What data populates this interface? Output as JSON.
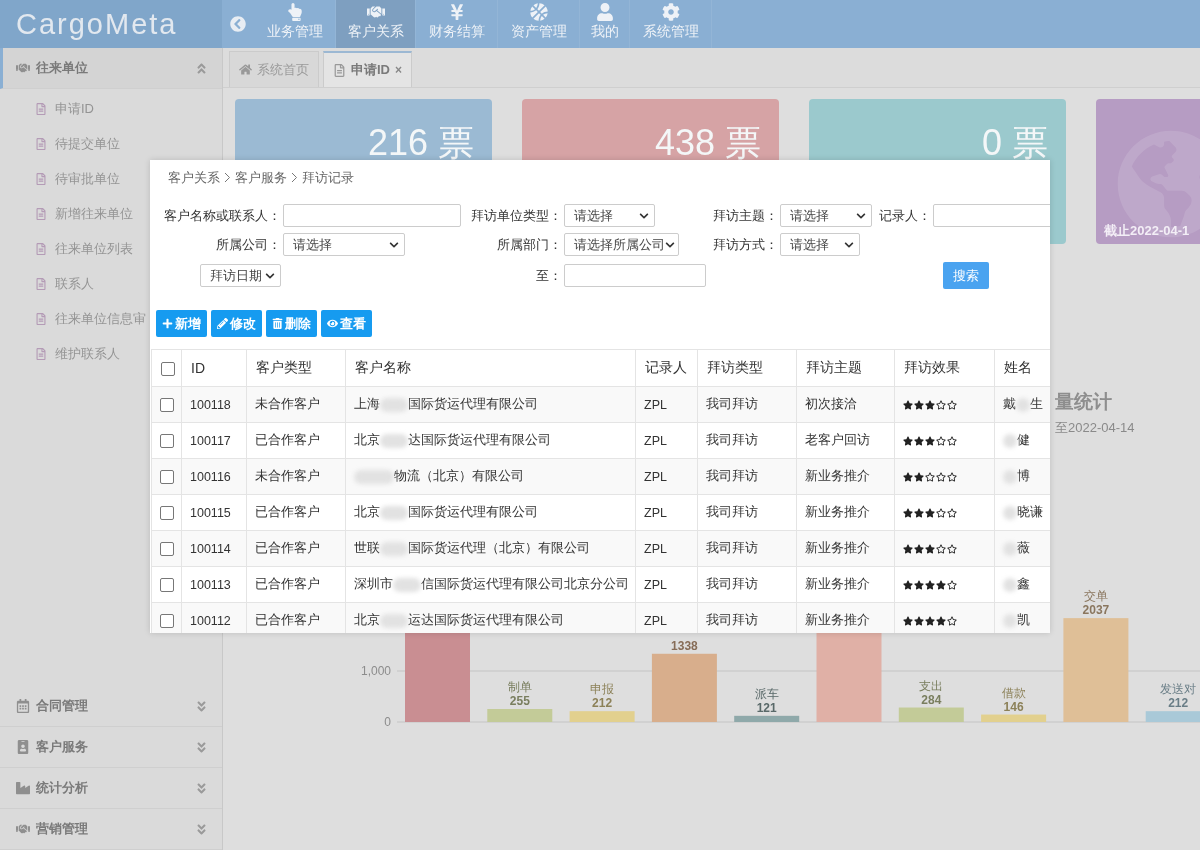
{
  "header": {
    "logo": "CargoMeta",
    "nav": [
      {
        "label": "业务管理",
        "selected": false
      },
      {
        "label": "客户关系",
        "selected": true
      },
      {
        "label": "财务结算",
        "selected": false
      },
      {
        "label": "资产管理",
        "selected": false
      },
      {
        "label": "我的",
        "selected": false
      },
      {
        "label": "系统管理",
        "selected": false
      }
    ]
  },
  "sidebar": {
    "sections": [
      {
        "title": "往来单位",
        "expanded": true,
        "items": [
          "申请ID",
          "待提交单位",
          "待审批单位",
          "新增往来单位",
          "往来单位列表",
          "联系人",
          "往来单位信息审",
          "维护联系人"
        ]
      },
      {
        "title": "合同管理",
        "expanded": false
      },
      {
        "title": "客户服务",
        "expanded": false
      },
      {
        "title": "统计分析",
        "expanded": false
      },
      {
        "title": "营销管理",
        "expanded": false
      }
    ]
  },
  "tabs": [
    {
      "label": "系统首页",
      "selected": false
    },
    {
      "label": "申请ID",
      "selected": true,
      "close": "×"
    }
  ],
  "cards": [
    {
      "value": "216 票",
      "color": "#9bbad3"
    },
    {
      "value": "438 票",
      "color": "#d6a3a5"
    },
    {
      "value": "0 票",
      "color": "#9bc9cd"
    },
    {
      "caption": "截止2022-04-1",
      "color": "#b69cc3"
    }
  ],
  "stats_panel": {
    "title": "量统计",
    "subtitle": "至2022-04-14",
    "axis_labels": [
      "1,000",
      "0"
    ],
    "bars": [
      {
        "color": "#c98e92"
      },
      {
        "label": "制单",
        "value": "255",
        "color": "#c3cb98"
      },
      {
        "label": "申报",
        "value": "212",
        "color": "#e2d08e"
      },
      {
        "value": "1338",
        "color": "#d8ae8c"
      },
      {
        "label": "派车",
        "value": "121",
        "color": "#8fa9aa"
      },
      {
        "color": "#e0b0a6"
      },
      {
        "label": "支出",
        "value": "284",
        "color": "#c3cb98"
      },
      {
        "label": "借款",
        "value": "146",
        "color": "#e2d08e"
      },
      {
        "label": "交单",
        "value": "2037",
        "color": "#dfbf97"
      },
      {
        "label": "发送对",
        "value": "212",
        "color": "#a9c9d8"
      }
    ]
  },
  "dialog": {
    "breadcrumb": [
      "客户关系",
      "客户服务",
      "拜访记录"
    ],
    "filter_rows": [
      [
        {
          "label": "客户名称或联系人：",
          "kind": "input"
        },
        {
          "label": "拜访单位类型：",
          "kind": "select",
          "value": "请选择"
        },
        {
          "label": "拜访主题：",
          "kind": "select",
          "value": "请选择"
        },
        {
          "label": "记录人：",
          "kind": "input"
        }
      ],
      [
        {
          "label": "所属公司：",
          "kind": "select",
          "value": "请选择"
        },
        {
          "label": "所属部门：",
          "kind": "select",
          "value": "请选择所属公司"
        },
        {
          "label": "拜访方式：",
          "kind": "select",
          "value": "请选择"
        }
      ],
      [
        {
          "kind": "date",
          "value": "拜访日期"
        },
        {
          "label": "至：",
          "kind": "input"
        }
      ]
    ],
    "search_button": "搜索",
    "actions": [
      "新增",
      "修改",
      "删除",
      "查看"
    ],
    "table": {
      "columns": [
        "ID",
        "客户类型",
        "客户名称",
        "记录人",
        "拜访类型",
        "拜访主题",
        "拜访效果",
        "姓名"
      ],
      "all_checked": false,
      "rows": [
        {
          "checked": false,
          "id": "100118",
          "type": "未合作客户",
          "name": {
            "start": "上海",
            "end": "国际货运代理有限公司"
          },
          "recorder": "ZPL",
          "visit_type": "我司拜访",
          "topic": "初次接洽",
          "stars": 3,
          "person": {
            "start": "戴",
            "end": "生"
          }
        },
        {
          "checked": false,
          "id": "100117",
          "type": "已合作客户",
          "name": {
            "start": "北京",
            "end": "达国际货运代理有限公司"
          },
          "recorder": "ZPL",
          "visit_type": "我司拜访",
          "topic": "老客户回访",
          "stars": 3,
          "person": {
            "end": "健"
          }
        },
        {
          "checked": false,
          "id": "100116",
          "type": "未合作客户",
          "name": {
            "end": "物流（北京）有限公司"
          },
          "recorder": "ZPL",
          "visit_type": "我司拜访",
          "topic": "新业务推介",
          "stars": 2,
          "person": {
            "end": "博"
          }
        },
        {
          "checked": false,
          "id": "100115",
          "type": "已合作客户",
          "name": {
            "start": "北京",
            "end": "国际货运代理有限公司"
          },
          "recorder": "ZPL",
          "visit_type": "我司拜访",
          "topic": "新业务推介",
          "stars": 3,
          "person": {
            "end": "晓谦"
          }
        },
        {
          "checked": false,
          "id": "100114",
          "type": "已合作客户",
          "name": {
            "start": "世联",
            "end": "国际货运代理（北京）有限公司"
          },
          "recorder": "ZPL",
          "visit_type": "我司拜访",
          "topic": "新业务推介",
          "stars": 3,
          "person": {
            "end": "薇"
          }
        },
        {
          "checked": false,
          "id": "100113",
          "type": "已合作客户",
          "name": {
            "start": "深圳市",
            "end": "信国际货运代理有限公司北京分公司"
          },
          "recorder": "ZPL",
          "visit_type": "我司拜访",
          "topic": "新业务推介",
          "stars": 4,
          "person": {
            "end": "鑫"
          }
        },
        {
          "checked": false,
          "id": "100112",
          "type": "已合作客户",
          "name": {
            "start": "北京",
            "end": "运达国际货运代理有限公司"
          },
          "recorder": "ZPL",
          "visit_type": "我司拜访",
          "topic": "新业务推介",
          "stars": 4,
          "person": {
            "end": "凯"
          }
        }
      ]
    }
  }
}
